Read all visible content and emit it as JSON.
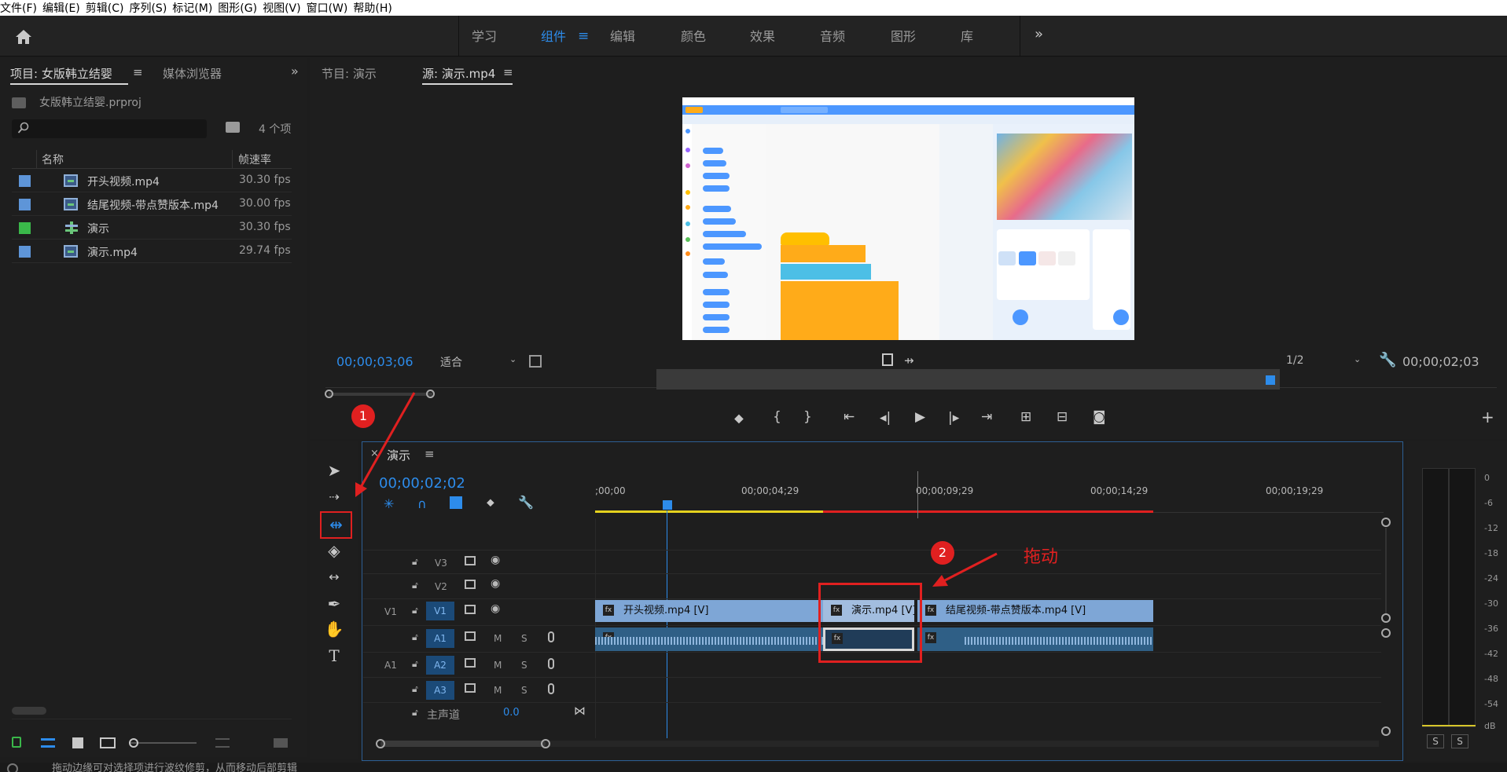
{
  "menu": [
    "文件(F)",
    "编辑(E)",
    "剪辑(C)",
    "序列(S)",
    "标记(M)",
    "图形(G)",
    "视图(V)",
    "窗口(W)",
    "帮助(H)"
  ],
  "workspaces": [
    "学习",
    "组件",
    "编辑",
    "颜色",
    "效果",
    "音频",
    "图形",
    "库"
  ],
  "project": {
    "tab": "项目: 女版韩立结婴",
    "tab2": "媒体浏览器",
    "file": "女版韩立结婴.prproj",
    "count": "4 个项",
    "col_name": "名称",
    "col_fps": "帧速率",
    "items": [
      {
        "name": "开头视频.mp4",
        "fps": "30.30 fps",
        "color": "#5e95d8"
      },
      {
        "name": "结尾视频-带点赞版本.mp4",
        "fps": "30.00 fps",
        "color": "#5e95d8"
      },
      {
        "name": "演示",
        "fps": "30.30 fps",
        "color": "#3ab84a"
      },
      {
        "name": "演示.mp4",
        "fps": "29.74 fps",
        "color": "#5e95d8"
      }
    ]
  },
  "monitor": {
    "tab1": "节目: 演示",
    "tab2": "源: 演示.mp4",
    "timecode_left": "00;00;03;06",
    "fit": "适合",
    "ratio": "1/2",
    "timecode_right": "00;00;02;03"
  },
  "timeline": {
    "tab": "演示",
    "timecode": "00;00;02;02",
    "ruler": [
      ";00;00",
      "00;00;04;29",
      "00;00;09;29",
      "00;00;14;29",
      "00;00;19;29"
    ],
    "tracks": {
      "v3": "V3",
      "v2": "V2",
      "v1": "V1",
      "a1": "A1",
      "a2": "A2",
      "a3": "A3",
      "src_v1": "V1",
      "src_a1": "A1",
      "master": "主声道",
      "master_val": "0.0",
      "m": "M",
      "s": "S"
    },
    "clips": {
      "c1": "开头视频.mp4 [V]",
      "c2": "演示.mp4 [V]",
      "c3": "结尾视频-带点赞版本.mp4 [V]"
    }
  },
  "annotation": {
    "n1": "1",
    "n2": "2",
    "drag": "拖动"
  },
  "meter": {
    "db": [
      "0",
      "-6",
      "-12",
      "-18",
      "-24",
      "-30",
      "-36",
      "-42",
      "-48",
      "-54",
      "dB"
    ],
    "s": "S"
  },
  "status": "拖动边缘可对选择项进行波纹修剪，从而移动后部剪辑"
}
